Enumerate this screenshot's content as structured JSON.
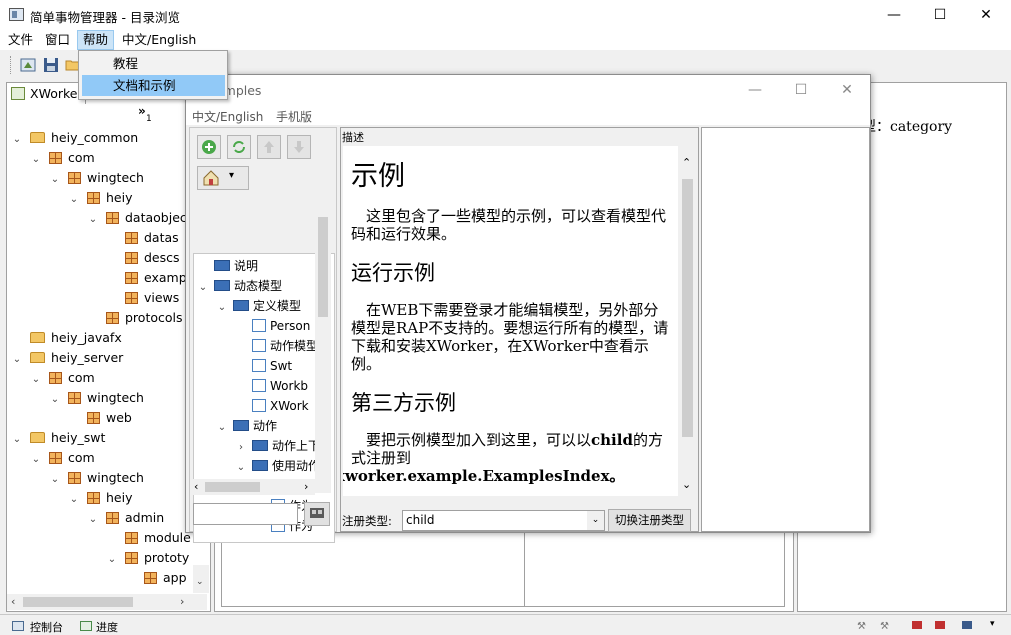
{
  "main_window": {
    "title": "简单事物管理器 - 目录浏览",
    "controls": {
      "minimize": "—",
      "maximize": "☐",
      "close": "✕"
    }
  },
  "menubar": {
    "items": [
      "文件",
      "窗口",
      "帮助",
      "中文/English"
    ],
    "active_index": 2
  },
  "help_menu": {
    "items": [
      "教程",
      "文档和示例"
    ],
    "highlighted_index": 1
  },
  "left_panel": {
    "tab_label": "XWorke",
    "toolbar_label": "»",
    "toolbar_index": "1",
    "tree": [
      {
        "label": "heiy_common",
        "kind": "folder",
        "depth": 0,
        "expanded": true
      },
      {
        "label": "com",
        "kind": "package",
        "depth": 1,
        "expanded": true
      },
      {
        "label": "wingtech",
        "kind": "package",
        "depth": 2,
        "expanded": true
      },
      {
        "label": "heiy",
        "kind": "package",
        "depth": 3,
        "expanded": true
      },
      {
        "label": "dataobjec",
        "kind": "package",
        "depth": 4,
        "expanded": true
      },
      {
        "label": "datas",
        "kind": "package",
        "depth": 5
      },
      {
        "label": "descs",
        "kind": "package",
        "depth": 5
      },
      {
        "label": "examp",
        "kind": "package",
        "depth": 5
      },
      {
        "label": "views",
        "kind": "package",
        "depth": 5
      },
      {
        "label": "protocols",
        "kind": "package",
        "depth": 4
      },
      {
        "label": "heiy_javafx",
        "kind": "folder",
        "depth": 0
      },
      {
        "label": "heiy_server",
        "kind": "folder",
        "depth": 0,
        "expanded": true
      },
      {
        "label": "com",
        "kind": "package",
        "depth": 1,
        "expanded": true
      },
      {
        "label": "wingtech",
        "kind": "package",
        "depth": 2,
        "expanded": true
      },
      {
        "label": "web",
        "kind": "package",
        "depth": 3
      },
      {
        "label": "heiy_swt",
        "kind": "folder",
        "depth": 0,
        "expanded": true
      },
      {
        "label": "com",
        "kind": "package",
        "depth": 1,
        "expanded": true
      },
      {
        "label": "wingtech",
        "kind": "package",
        "depth": 2,
        "expanded": true
      },
      {
        "label": "heiy",
        "kind": "package",
        "depth": 3,
        "expanded": true
      },
      {
        "label": "admin",
        "kind": "package",
        "depth": 4,
        "expanded": true
      },
      {
        "label": "module",
        "kind": "package",
        "depth": 5
      },
      {
        "label": "prototy",
        "kind": "package",
        "depth": 5,
        "expanded": true
      },
      {
        "label": "app",
        "kind": "package",
        "depth": 6
      }
    ]
  },
  "right_panel": {
    "text": "型：category"
  },
  "bottom_tabs": [
    "控制台",
    "进度"
  ],
  "examples_window": {
    "title": "amples",
    "menu": [
      "中文/English",
      "手机版"
    ],
    "tree": [
      {
        "label": "说明",
        "icon": "html",
        "depth": 0
      },
      {
        "label": "动态模型",
        "icon": "html",
        "depth": 0,
        "expanded": true
      },
      {
        "label": "定义模型",
        "icon": "html",
        "depth": 1,
        "expanded": true
      },
      {
        "label": "Person",
        "icon": "page",
        "depth": 2
      },
      {
        "label": "动作模型",
        "icon": "page",
        "depth": 2
      },
      {
        "label": "Swt",
        "icon": "page",
        "depth": 2
      },
      {
        "label": "Workb",
        "icon": "page",
        "depth": 2
      },
      {
        "label": "XWork",
        "icon": "page",
        "depth": 2
      },
      {
        "label": "动作",
        "icon": "html",
        "depth": 1,
        "expanded": true
      },
      {
        "label": "动作上下",
        "icon": "html",
        "depth": 2,
        "collapsed": true
      },
      {
        "label": "使用动作",
        "icon": "html",
        "depth": 2,
        "expanded": true
      },
      {
        "label": "编写",
        "icon": "page",
        "depth": 3
      },
      {
        "label": "作为",
        "icon": "page",
        "depth": 3
      },
      {
        "label": "作为",
        "icon": "page",
        "depth": 3
      }
    ],
    "search_value": "",
    "description_label": "描述",
    "doc": {
      "h1": "示例",
      "p1": "这里包含了一些模型的示例，可以查看模型代码和运行效果。",
      "h2a": "运行示例",
      "p2": "在WEB下需要登录才能编辑模型，另外部分模型是RAP不支持的。要想运行所有的模型，请下载和安装XWorker，在XWorker中查看示例。",
      "h2b": "第三方示例",
      "p3_pre": "要把示例模型加入到这里，可以以",
      "p3_bold": "child",
      "p3_post": "的方式注册到",
      "p3_code": "xworker.example.ExamplesIndex。"
    },
    "register_label": "注册类型:",
    "register_value": "child",
    "switch_button": "切换注册类型"
  }
}
